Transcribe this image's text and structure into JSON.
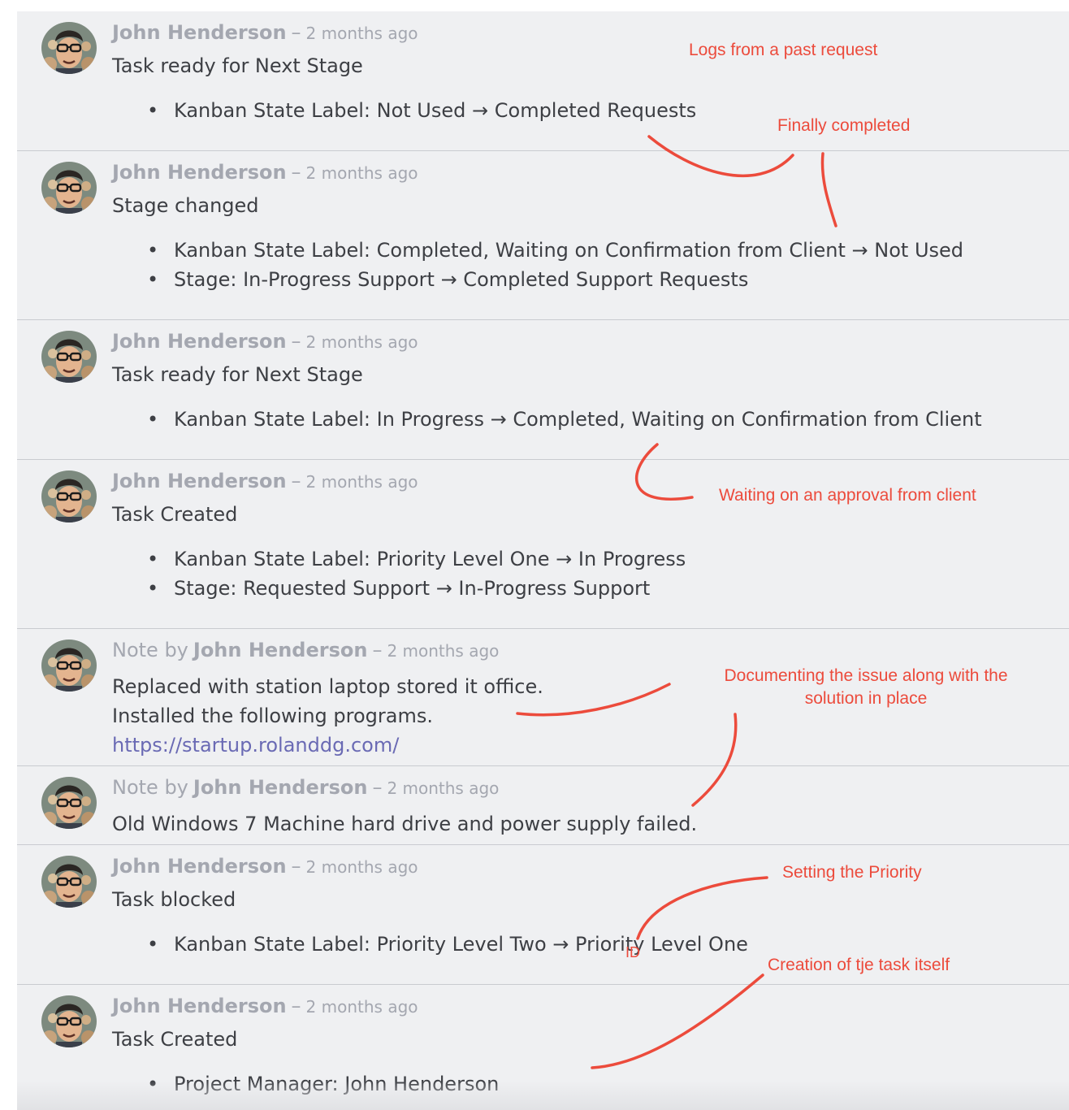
{
  "entries": [
    {
      "author": "John Henderson",
      "time": "2 months ago",
      "title": "Task ready for Next Stage",
      "changes": [
        "Kanban State Label: Not Used → Completed Requests"
      ]
    },
    {
      "author": "John Henderson",
      "time": "2 months ago",
      "title": "Stage changed",
      "changes": [
        "Kanban State Label: Completed, Waiting on Confirmation from Client → Not Used",
        "Stage: In-Progress Support → Completed Support Requests"
      ]
    },
    {
      "author": "John Henderson",
      "time": "2 months ago",
      "title": "Task ready for Next Stage",
      "changes": [
        "Kanban State Label: In Progress → Completed, Waiting on Confirmation from Client"
      ]
    },
    {
      "author": "John Henderson",
      "time": "2 months ago",
      "title": "Task Created",
      "changes": [
        "Kanban State Label: Priority Level One → In Progress",
        "Stage: Requested Support → In-Progress Support"
      ]
    },
    {
      "note_prefix": "Note by",
      "author": "John Henderson",
      "time": "2 months ago",
      "lines": [
        "Replaced with station laptop stored it office.",
        "Installed the following programs."
      ],
      "link": "https://startup.rolanddg.com/"
    },
    {
      "note_prefix": "Note by",
      "author": "John Henderson",
      "time": "2 months ago",
      "lines": [
        "Old Windows 7 Machine hard drive and power supply failed."
      ]
    },
    {
      "author": "John Henderson",
      "time": "2 months ago",
      "title": "Task blocked",
      "changes": [
        "Kanban State Label: Priority Level Two → Priority Level One"
      ]
    },
    {
      "author": "John Henderson",
      "time": "2 months ago",
      "title": "Task Created",
      "changes": [
        "Project Manager: John Henderson"
      ]
    }
  ],
  "separator": "–",
  "annotations": {
    "past_request": "Logs from a past request",
    "finally_completed": "Finally completed",
    "waiting_approval": "Waiting on an approval from client",
    "documenting": "Documenting the issue along with the solution in place",
    "setting_priority": "Setting the Priority",
    "creation": "Creation of tje task itself",
    "stray_mark": "ID"
  },
  "colors": {
    "annotation": "#ec4b3c",
    "background": "#eff0f2",
    "link": "#6a6ab4",
    "muted": "#a4a7b0",
    "text": "#3d3f44"
  }
}
